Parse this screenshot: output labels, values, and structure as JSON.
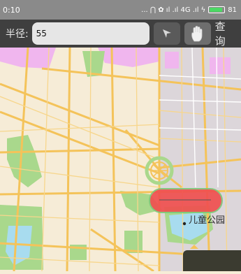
{
  "status_bar": {
    "time": "0:10",
    "icons": "... ⋂ ✿ ıl .ıl 4G .ıl ϟ",
    "battery": "81"
  },
  "toolbar": {
    "radius_label": "半径:",
    "radius_value": "55",
    "query_label": "查 询"
  },
  "map": {
    "poi_name": "儿童公园"
  },
  "colors": {
    "status_bg": "#8a8a8a",
    "toolbar_bg": "#3f3f3f",
    "map_bg": "#f6ecd7",
    "road": "#f4c35a",
    "park": "#a9d88c",
    "district": "#f2b8ef",
    "block": "#d8d4da",
    "water": "#a8dcef",
    "marker": "#f05050"
  }
}
